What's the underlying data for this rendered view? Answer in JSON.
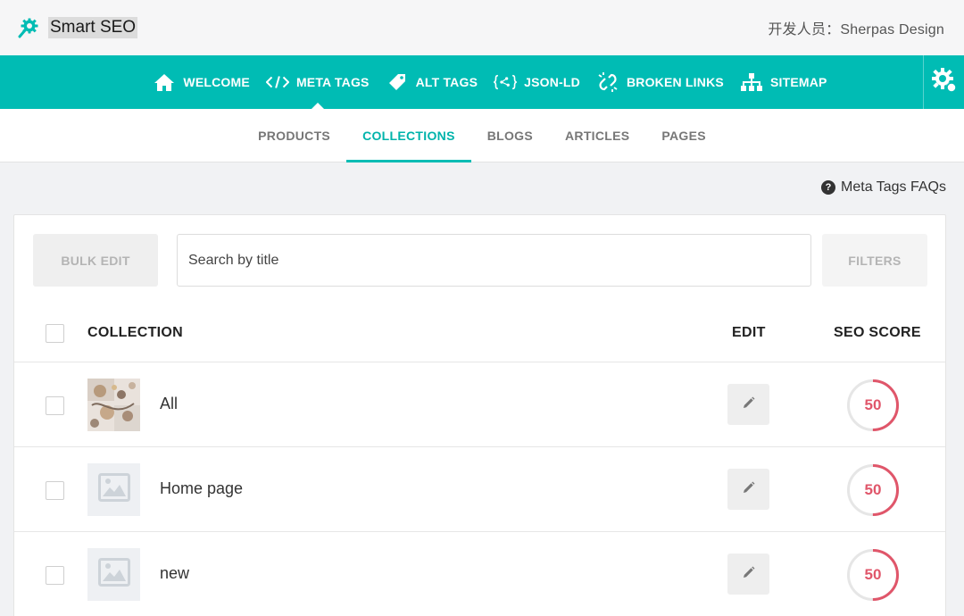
{
  "app": {
    "title": "Smart SEO",
    "developer": "开发人员：Sherpas Design",
    "logo_icon": "gear-magnifier-icon"
  },
  "colors": {
    "primary": "#00bcb4",
    "score": "#e0566a"
  },
  "main_nav": [
    {
      "label": "WELCOME",
      "icon": "home-icon"
    },
    {
      "label": "META TAGS",
      "icon": "code-icon",
      "active": true
    },
    {
      "label": "ALT TAGS",
      "icon": "tag-icon"
    },
    {
      "label": "JSON-LD",
      "icon": "json-braces-icon"
    },
    {
      "label": "BROKEN LINKS",
      "icon": "broken-link-icon"
    },
    {
      "label": "SITEMAP",
      "icon": "sitemap-icon"
    }
  ],
  "settings_icon": "settings-gear-icon",
  "tabs": [
    {
      "label": "PRODUCTS"
    },
    {
      "label": "COLLECTIONS",
      "active": true
    },
    {
      "label": "BLOGS"
    },
    {
      "label": "ARTICLES"
    },
    {
      "label": "PAGES"
    }
  ],
  "faq": {
    "label": "Meta Tags FAQs",
    "icon_glyph": "?"
  },
  "toolbar": {
    "bulk_edit": "BULK EDIT",
    "search_placeholder": "Search by title",
    "filters": "FILTERS"
  },
  "table": {
    "headers": {
      "collection": "COLLECTION",
      "edit": "EDIT",
      "seo_score": "SEO SCORE"
    },
    "rows": [
      {
        "title": "All",
        "thumbnail": "photo",
        "score": "50",
        "score_value": 50
      },
      {
        "title": "Home page",
        "thumbnail": "placeholder-image-icon",
        "score": "50",
        "score_value": 50
      },
      {
        "title": "new",
        "thumbnail": "placeholder-image-icon",
        "score": "50",
        "score_value": 50
      }
    ]
  }
}
